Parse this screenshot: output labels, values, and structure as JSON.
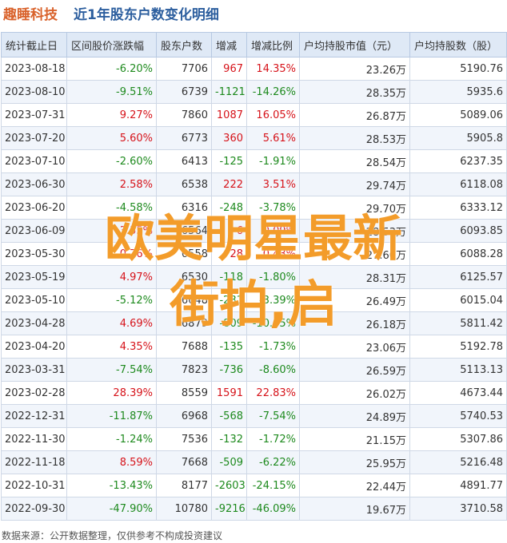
{
  "header": {
    "company": "趣睡科技",
    "subtitle": "近1年股东户数变化明细"
  },
  "columns": [
    "统计截止日",
    "区间股价涨跌幅",
    "股东户数",
    "增减",
    "增减比例",
    "户均持股市值（元）",
    "户均持股数（股）"
  ],
  "rows": [
    {
      "date": "2023-08-18",
      "pct": "-6.20%",
      "holders": "7706",
      "change": "967",
      "ratio": "14.35%",
      "avg_value": "23.26万",
      "avg_shares": "5190.76"
    },
    {
      "date": "2023-08-10",
      "pct": "-9.51%",
      "holders": "6739",
      "change": "-1121",
      "ratio": "-14.26%",
      "avg_value": "28.35万",
      "avg_shares": "5935.6"
    },
    {
      "date": "2023-07-31",
      "pct": "9.27%",
      "holders": "7860",
      "change": "1087",
      "ratio": "16.05%",
      "avg_value": "26.87万",
      "avg_shares": "5089.06"
    },
    {
      "date": "2023-07-20",
      "pct": "5.60%",
      "holders": "6773",
      "change": "360",
      "ratio": "5.61%",
      "avg_value": "28.53万",
      "avg_shares": "5905.8"
    },
    {
      "date": "2023-07-10",
      "pct": "-2.60%",
      "holders": "6413",
      "change": "-125",
      "ratio": "-1.91%",
      "avg_value": "28.54万",
      "avg_shares": "6237.35"
    },
    {
      "date": "2023-06-30",
      "pct": "2.58%",
      "holders": "6538",
      "change": "222",
      "ratio": "3.51%",
      "avg_value": "29.74万",
      "avg_shares": "6118.08"
    },
    {
      "date": "2023-06-20",
      "pct": "-4.58%",
      "holders": "6316",
      "change": "-248",
      "ratio": "-3.78%",
      "avg_value": "29.70万",
      "avg_shares": "6333.12"
    },
    {
      "date": "2023-06-09",
      "pct": "3.55%",
      "holders": "6564",
      "change": "6",
      "ratio": "0.09%",
      "avg_value": "28.53万",
      "avg_shares": "6093.85"
    },
    {
      "date": "2023-05-30",
      "pct": "0.76%",
      "holders": "6558",
      "change": "28",
      "ratio": "0.43%",
      "avg_value": "27.60万",
      "avg_shares": "6088.28"
    },
    {
      "date": "2023-05-19",
      "pct": "4.97%",
      "holders": "6530",
      "change": "-118",
      "ratio": "-1.80%",
      "avg_value": "28.31万",
      "avg_shares": "6125.57"
    },
    {
      "date": "2023-05-10",
      "pct": "-5.12%",
      "holders": "6648",
      "change": "-231",
      "ratio": "-3.39%",
      "avg_value": "26.49万",
      "avg_shares": "6015.04"
    },
    {
      "date": "2023-04-28",
      "pct": "4.69%",
      "holders": "6879",
      "change": "-809",
      "ratio": "-10.65%",
      "avg_value": "26.18万",
      "avg_shares": "5811.42"
    },
    {
      "date": "2023-04-20",
      "pct": "4.35%",
      "holders": "7688",
      "change": "-135",
      "ratio": "-1.73%",
      "avg_value": "23.06万",
      "avg_shares": "5192.78"
    },
    {
      "date": "2023-03-31",
      "pct": "-7.54%",
      "holders": "7823",
      "change": "-736",
      "ratio": "-8.60%",
      "avg_value": "26.59万",
      "avg_shares": "5113.13"
    },
    {
      "date": "2023-02-28",
      "pct": "28.39%",
      "holders": "8559",
      "change": "1591",
      "ratio": "22.83%",
      "avg_value": "26.02万",
      "avg_shares": "4673.44"
    },
    {
      "date": "2022-12-31",
      "pct": "-11.87%",
      "holders": "6968",
      "change": "-568",
      "ratio": "-7.54%",
      "avg_value": "24.89万",
      "avg_shares": "5740.53"
    },
    {
      "date": "2022-11-30",
      "pct": "-1.24%",
      "holders": "7536",
      "change": "-132",
      "ratio": "-1.72%",
      "avg_value": "21.15万",
      "avg_shares": "5307.86"
    },
    {
      "date": "2022-11-18",
      "pct": "8.59%",
      "holders": "7668",
      "change": "-509",
      "ratio": "-6.22%",
      "avg_value": "25.95万",
      "avg_shares": "5216.48"
    },
    {
      "date": "2022-10-31",
      "pct": "-13.43%",
      "holders": "8177",
      "change": "-2603",
      "ratio": "-24.15%",
      "avg_value": "22.44万",
      "avg_shares": "4891.77"
    },
    {
      "date": "2022-09-30",
      "pct": "-47.90%",
      "holders": "10780",
      "change": "-9216",
      "ratio": "-46.09%",
      "avg_value": "19.67万",
      "avg_shares": "3710.58"
    }
  ],
  "overlay": {
    "line1": "欧美明星最新",
    "line2": "街拍,启"
  },
  "footer": "数据来源：公开数据整理，仅供参考不构成投资建议",
  "colors": {
    "positive": "#d6131a",
    "negative": "#1e8a1e",
    "header_bg": "#dfe9f6",
    "overlay": "#f39c2a"
  }
}
